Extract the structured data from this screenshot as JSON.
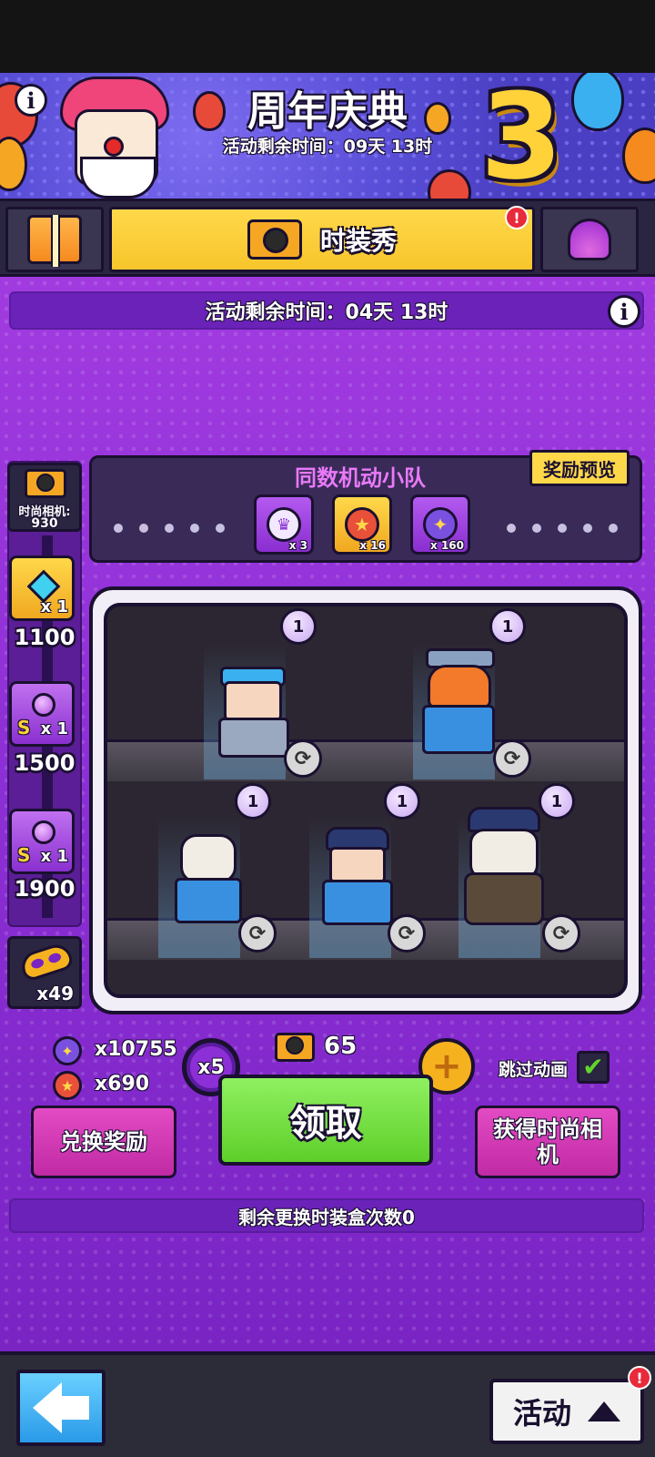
{
  "banner": {
    "title": "周年庆典",
    "countdown": "活动剩余时间：09天 13时",
    "anniversary_number": "3"
  },
  "tabs": {
    "active_label": "时装秀",
    "alert": "!"
  },
  "event": {
    "countdown": "活动剩余时间：04天 13时",
    "info": "i"
  },
  "sidebar": {
    "camera_label": "时尚相机:",
    "camera_count": "930",
    "milestones": [
      {
        "chest": "gold",
        "qty": "x 1",
        "points": "1100",
        "tier": ""
      },
      {
        "chest": "purple",
        "qty": "x 1",
        "points": "1500",
        "tier": "S"
      },
      {
        "chest": "purple",
        "qty": "x 1",
        "points": "1900",
        "tier": "S"
      }
    ],
    "mask_qty": "x49"
  },
  "squad": {
    "title": "同数机动小队",
    "preview_button": "奖励预览",
    "rewards": [
      {
        "icon": "crown-medal-icon",
        "qty": "x 3",
        "color": "#9a3de0"
      },
      {
        "icon": "star-medal-icon",
        "qty": "x 16",
        "color": "#f5b21e"
      },
      {
        "icon": "sparkle-medal-icon",
        "qty": "x 160",
        "color": "#9a3de0"
      }
    ]
  },
  "showcase": {
    "slots": [
      {
        "badge": "1",
        "character": "goggles-police"
      },
      {
        "badge": "1",
        "character": "redhair-police"
      },
      {
        "badge": "1",
        "character": "cat-police"
      },
      {
        "badge": "1",
        "character": "ninja-police"
      },
      {
        "badge": "1",
        "character": "panda-police"
      }
    ]
  },
  "controls": {
    "currency_a": "x10755",
    "currency_b": "x690",
    "multiplier": "x5",
    "camera_cost": "65",
    "claim_button": "领取",
    "skip_animation": "跳过动画",
    "exchange_button": "兑换奖励",
    "get_camera_button": "获得时尚相机",
    "remaining_changes": "剩余更换时装盒次数0"
  },
  "nav": {
    "activity_label": "活动",
    "alert": "!"
  },
  "colors": {
    "accent_yellow": "#f7c52b",
    "purple_bg": "#8d2fd6",
    "pink_button": "#d236b4",
    "green_button": "#6ad83a"
  }
}
